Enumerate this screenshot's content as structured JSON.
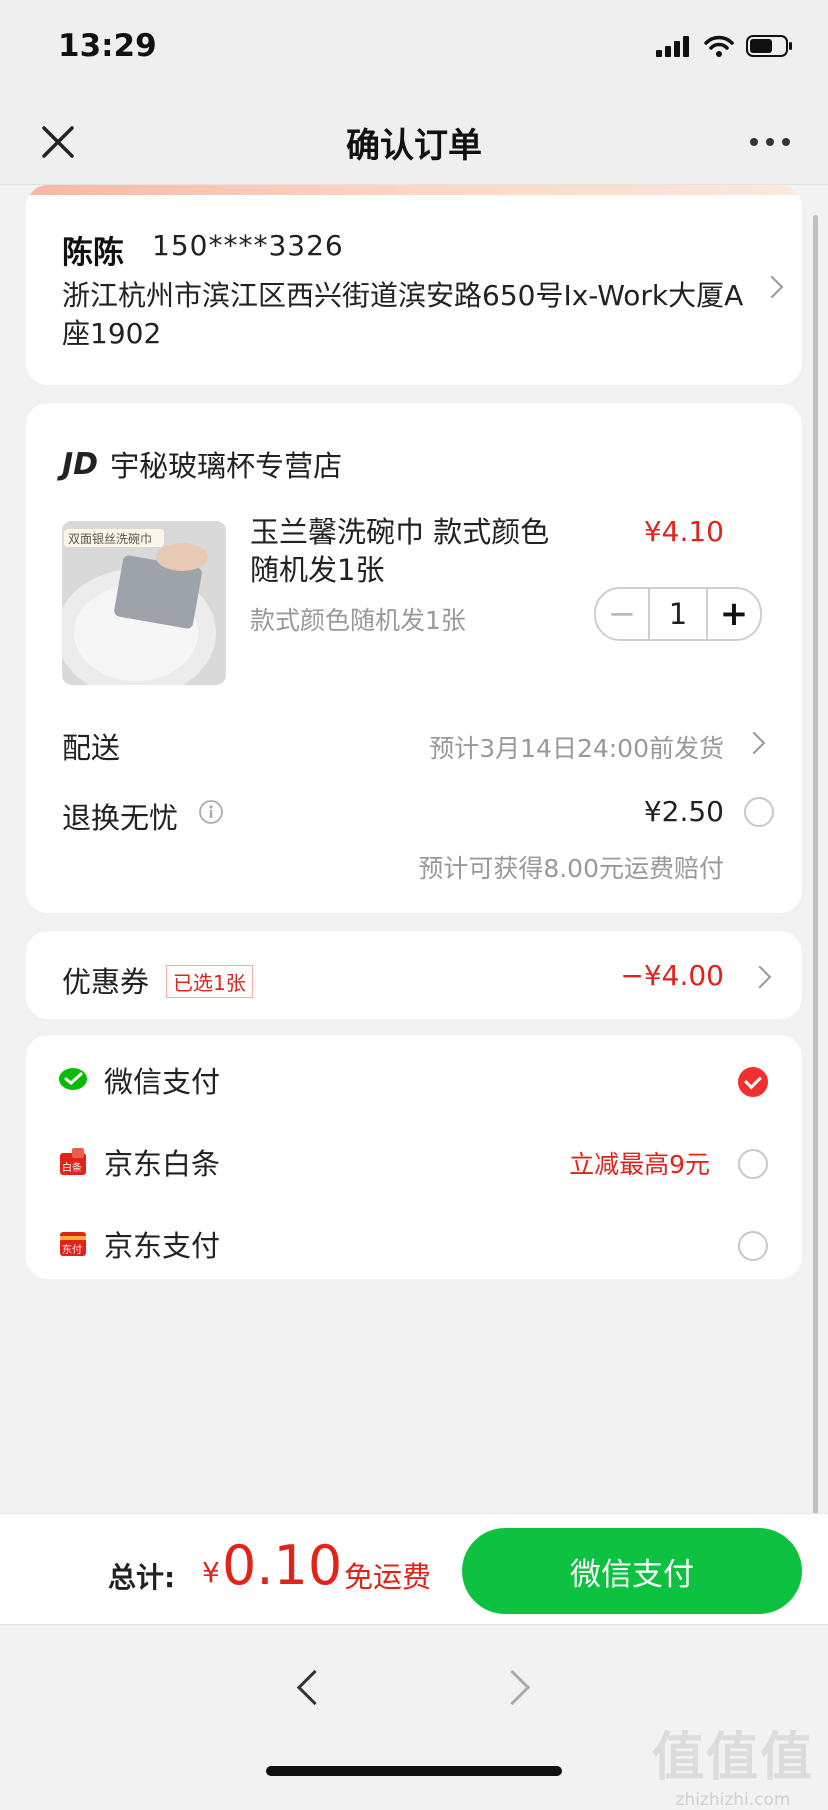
{
  "status": {
    "time": "13:29"
  },
  "nav": {
    "title": "确认订单"
  },
  "address": {
    "name": "陈陈",
    "phone": "150****3326",
    "detail": "浙江杭州市滨江区西兴街道滨安路650号Ix-Work大厦A座1902"
  },
  "order": {
    "store_logo": "JD",
    "store_name": "宇秘玻璃杯专营店",
    "product": {
      "image_label": "双面银丝洗碗巾",
      "title": "玉兰馨洗碗巾 款式颜色随机发1张",
      "price": "¥4.10",
      "spec": "款式颜色随机发1张",
      "quantity": "1",
      "minus": "−",
      "plus": "+"
    },
    "delivery": {
      "label": "配送",
      "value": "预计3月14日24:00前发货"
    },
    "return": {
      "label": "退换无忧",
      "price": "¥2.50",
      "note": "预计可获得8.00元运费赔付"
    }
  },
  "coupon": {
    "label": "优惠券",
    "tag": "已选1张",
    "value": "−¥4.00"
  },
  "payment": {
    "methods": [
      {
        "label": "微信支付",
        "promo": "",
        "icon": "wechat-pay-icon",
        "selected": true,
        "color": "#09bb07"
      },
      {
        "label": "京东白条",
        "promo": "立减最高9元",
        "icon": "jd-baitiao-icon",
        "selected": false,
        "color": "#e2231a"
      },
      {
        "label": "京东支付",
        "promo": "",
        "icon": "jd-pay-icon",
        "selected": false,
        "color": "#e2231a"
      }
    ]
  },
  "summary": {
    "total_label": "总计:",
    "yen": "¥",
    "amount": "0.10",
    "free_shipping": "免运费",
    "pay_button": "微信支付"
  },
  "watermark": {
    "big": "值值值",
    "small": "zhizhizhi.com"
  },
  "colors": {
    "accent_red": "#e2231a",
    "pay_green": "#0dc241"
  }
}
